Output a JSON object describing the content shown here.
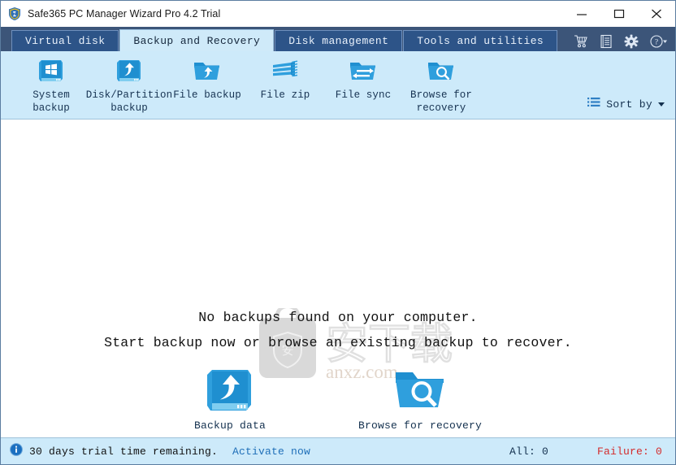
{
  "window": {
    "title": "Safe365 PC Manager Wizard Pro 4.2 Trial",
    "logo_icon": "shield-logo-icon",
    "minimize_label": "Minimize",
    "maximize_label": "Maximize",
    "close_label": "Close"
  },
  "tabs": [
    {
      "label": "Virtual disk",
      "active": false
    },
    {
      "label": "Backup and Recovery",
      "active": true
    },
    {
      "label": "Disk management",
      "active": false
    },
    {
      "label": "Tools and utilities",
      "active": false
    }
  ],
  "header_icons": [
    {
      "name": "cart-icon",
      "title": "Buy"
    },
    {
      "name": "license-icon",
      "title": "License"
    },
    {
      "name": "gear-icon",
      "title": "Settings"
    },
    {
      "name": "help-icon",
      "title": "Help"
    }
  ],
  "toolbar": {
    "items": [
      {
        "label": "System backup",
        "icon": "system-backup-icon"
      },
      {
        "label": "Disk/Partition backup",
        "icon": "disk-partition-backup-icon"
      },
      {
        "label": "File backup",
        "icon": "file-backup-icon"
      },
      {
        "label": "File zip",
        "icon": "file-zip-icon"
      },
      {
        "label": "File sync",
        "icon": "file-sync-icon"
      },
      {
        "label": "Browse for recovery",
        "icon": "browse-recovery-icon"
      }
    ],
    "sort_by_label": "Sort by",
    "sort_by_icon": "list-icon"
  },
  "main": {
    "message_line1": "No backups found on your computer.",
    "message_line2": "Start backup now or browse an existing backup to recover.",
    "watermark_text": "anxz.com",
    "watermark_cjk": "安下载",
    "actions": [
      {
        "label": "Backup data",
        "icon": "backup-data-icon"
      },
      {
        "label": "Browse for recovery",
        "icon": "browse-recovery-icon"
      }
    ]
  },
  "statusbar": {
    "info_icon": "info-icon",
    "trial_text": "30 days trial time remaining.",
    "activate_label": "Activate now",
    "all_label": "All:  0",
    "failure_label": "Failure:  0"
  },
  "colors": {
    "tabstrip_bg": "#3c5579",
    "tab_inactive_bg": "#2d5488",
    "tab_active_bg": "#cfeaf9",
    "toolbar_bg": "#cdeafa",
    "accent_blue": "#1e92d8",
    "link_blue": "#1f6fb8",
    "failure_red": "#d42a2a"
  }
}
